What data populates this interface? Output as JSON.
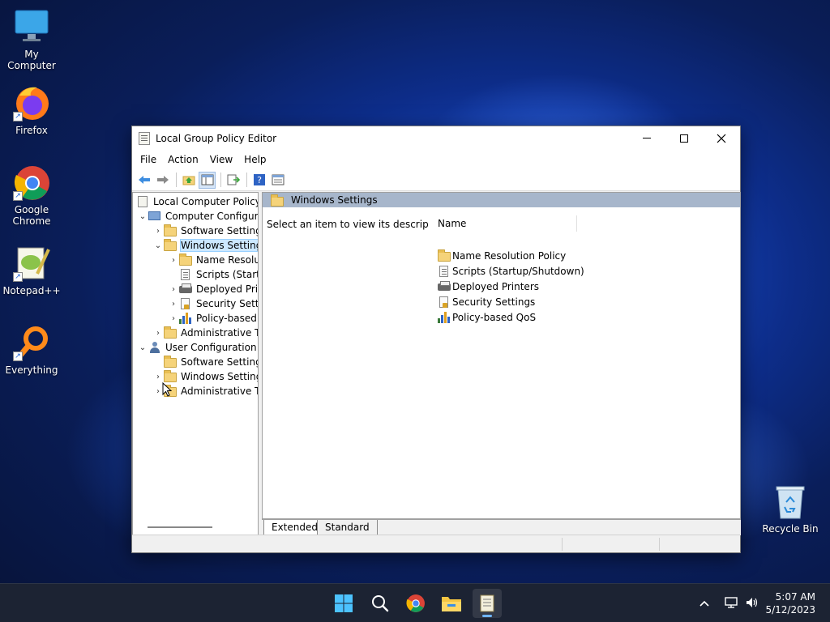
{
  "desktop": {
    "icons": [
      {
        "label": "My Computer",
        "icon": "monitor-icon"
      },
      {
        "label": "Firefox",
        "icon": "firefox-icon"
      },
      {
        "label": "Google Chrome",
        "icon": "chrome-icon"
      },
      {
        "label": "Notepad++",
        "icon": "notepad-plus-plus-icon"
      },
      {
        "label": "Everything",
        "icon": "magnifier-icon"
      },
      {
        "label": "Recycle Bin",
        "icon": "recycle-bin-icon"
      }
    ]
  },
  "window": {
    "title": "Local Group Policy Editor",
    "menu": [
      "File",
      "Action",
      "View",
      "Help"
    ],
    "toolbar_icons": [
      "back-arrow-icon",
      "forward-arrow-icon",
      "up-folder-icon",
      "show-hide-tree-icon",
      "export-list-icon",
      "help-icon",
      "properties-icon"
    ]
  },
  "tree": {
    "items": [
      {
        "label": "Local Computer Policy",
        "chevron": "",
        "icon": "policy-icon"
      },
      {
        "label": "Computer Configura",
        "chevron": "⌄",
        "icon": "computer-icon"
      },
      {
        "label": "Software Settings",
        "chevron": "›",
        "icon": "folder-icon"
      },
      {
        "label": "Windows Setting",
        "chevron": "⌄",
        "icon": "folder-icon",
        "selected": true
      },
      {
        "label": "Name Resolu",
        "chevron": "›",
        "icon": "folder-icon"
      },
      {
        "label": "Scripts (Startu",
        "chevron": "",
        "icon": "script-icon"
      },
      {
        "label": "Deployed Prir",
        "chevron": "›",
        "icon": "printer-icon"
      },
      {
        "label": "Security Settin",
        "chevron": "›",
        "icon": "security-icon"
      },
      {
        "label": "Policy-based",
        "chevron": "›",
        "icon": "qos-icon"
      },
      {
        "label": "Administrative Te",
        "chevron": "›",
        "icon": "folder-icon"
      },
      {
        "label": "User Configuration",
        "chevron": "⌄",
        "icon": "user-icon"
      },
      {
        "label": "Software Settings",
        "chevron": "",
        "icon": "folder-icon"
      },
      {
        "label": "Windows Setting",
        "chevron": "›",
        "icon": "folder-icon"
      },
      {
        "label": "Administrative Te",
        "chevron": "›",
        "icon": "folder-icon"
      }
    ]
  },
  "details": {
    "header": "Windows Settings",
    "description": "Select an item to view its description.",
    "column_name": "Name",
    "items": [
      {
        "label": "Name Resolution Policy",
        "icon": "folder-icon"
      },
      {
        "label": "Scripts (Startup/Shutdown)",
        "icon": "script-icon"
      },
      {
        "label": "Deployed Printers",
        "icon": "printer-icon"
      },
      {
        "label": "Security Settings",
        "icon": "security-icon"
      },
      {
        "label": "Policy-based QoS",
        "icon": "qos-icon"
      }
    ],
    "tabs": [
      "Extended",
      "Standard"
    ]
  },
  "taskbar": {
    "apps": [
      "start-icon",
      "search-icon",
      "chrome-icon",
      "file-explorer-icon",
      "notepad-icon"
    ],
    "time": "5:07 AM",
    "date": "5/12/2023"
  }
}
